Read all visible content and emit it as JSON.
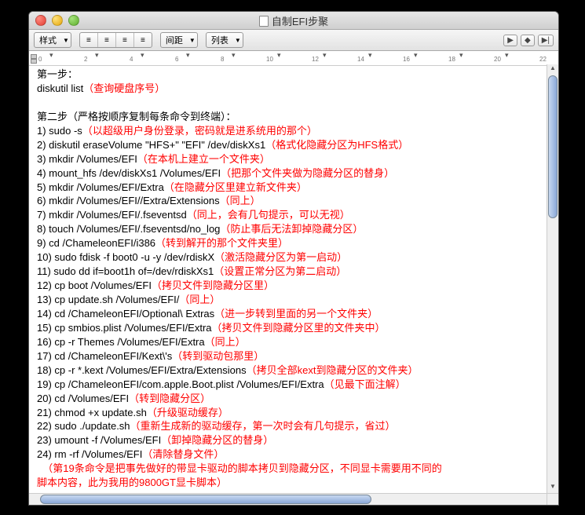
{
  "window": {
    "title": "自制EFI步聚"
  },
  "toolbar": {
    "style_label": "样式",
    "spacing_label": "间距",
    "list_label": "列表"
  },
  "body": {
    "step1_head": "第一步：",
    "step1_cmd": "diskutil list",
    "step1_note": "（查询硬盘序号）",
    "blank": " ",
    "step2_head": "第二步（严格按顺序复制每条命令到终端）：",
    "lines": [
      {
        "n": "1)",
        "cmd": "   sudo -s",
        "note": "（以超级用户身份登录，密码就是进系统用的那个）"
      },
      {
        "n": "2)",
        "cmd": "   diskutil eraseVolume \"HFS+\" \"EFI\" /dev/diskXs1",
        "note": "（格式化隐藏分区为HFS格式）"
      },
      {
        "n": "3)",
        "cmd": "   mkdir /Volumes/EFI",
        "note": "（在本机上建立一个文件夹）"
      },
      {
        "n": "4)",
        "cmd": "   mount_hfs /dev/diskXs1 /Volumes/EFI",
        "note": "（把那个文件夹做为隐藏分区的替身）"
      },
      {
        "n": "5)",
        "cmd": "   mkdir /Volumes/EFI/Extra",
        "note": "（在隐藏分区里建立新文件夹）"
      },
      {
        "n": "6)",
        "cmd": "   mkdir /Volumes/EFI//Extra/Extensions",
        "note": "（同上）"
      },
      {
        "n": "7)",
        "cmd": "   mkdir /Volumes/EFI/.fseventsd",
        "note": "（同上，会有几句提示，可以无视）"
      },
      {
        "n": "8)",
        "cmd": "   touch /Volumes/EFI/.fseventsd/no_log",
        "note": "（防止事后无法卸掉隐藏分区）"
      },
      {
        "n": "9)",
        "cmd": "   cd /ChameleonEFI/i386",
        "note": "（转到解开的那个文件夹里）"
      },
      {
        "n": "10)",
        "cmd": " sudo fdisk -f boot0 -u -y /dev/rdiskX",
        "note": "（激活隐藏分区为第一启动）"
      },
      {
        "n": "11)",
        "cmd": " sudo dd if=boot1h of=/dev/rdiskXs1",
        "note": "（设置正常分区为第二启动）"
      },
      {
        "n": "12)",
        "cmd": " cp boot /Volumes/EFI",
        "note": "（拷贝文件到隐藏分区里）"
      },
      {
        "n": "13)",
        "cmd": " cp update.sh /Volumes/EFI/",
        "note": "（同上）"
      },
      {
        "n": "14)",
        "cmd": " cd /ChameleonEFI/Optional\\ Extras",
        "note": "（进一步转到里面的另一个文件夹）"
      },
      {
        "n": "15)",
        "cmd": " cp smbios.plist /Volumes/EFI/Extra",
        "note": "（拷贝文件到隐藏分区里的文件夹中）"
      },
      {
        "n": "16)",
        "cmd": " cp -r Themes /Volumes/EFI/Extra",
        "note": "（同上）"
      },
      {
        "n": "17)",
        "cmd": " cd /ChameleonEFI/Kext\\'s",
        "note": "（转到驱动包那里）"
      },
      {
        "n": "18)",
        "cmd": " cp -r *.kext /Volumes/EFI/Extra/Extensions",
        "note": "（拷贝全部kext到隐藏分区的文件夹）"
      },
      {
        "n": "19)",
        "cmd": " cp /ChameleonEFI/com.apple.Boot.plist /Volumes/EFI/Extra",
        "note": "（见最下面注解）"
      },
      {
        "n": "20)",
        "cmd": " cd /Volumes/EFI",
        "note": "（转到隐藏分区）"
      },
      {
        "n": "21)",
        "cmd": " chmod +x update.sh",
        "note": "（升级驱动缓存）"
      },
      {
        "n": "22)",
        "cmd": " sudo ./update.sh",
        "note": "（重新生成新的驱动缓存，第一次时会有几句提示，省过）"
      },
      {
        "n": "23)",
        "cmd": " umount -f /Volumes/EFI",
        "note": "（卸掉隐藏分区的替身）"
      },
      {
        "n": "24)",
        "cmd": " rm -rf /Volumes/EFI",
        "note": "（清除替身文件）"
      }
    ],
    "foot1": "（第19条命令是把事先做好的带显卡驱动的脚本拷贝到隐藏分区，不同显卡需要用不同的",
    "foot2": "脚本内容，此为我用的9800GT显卡脚本）"
  }
}
